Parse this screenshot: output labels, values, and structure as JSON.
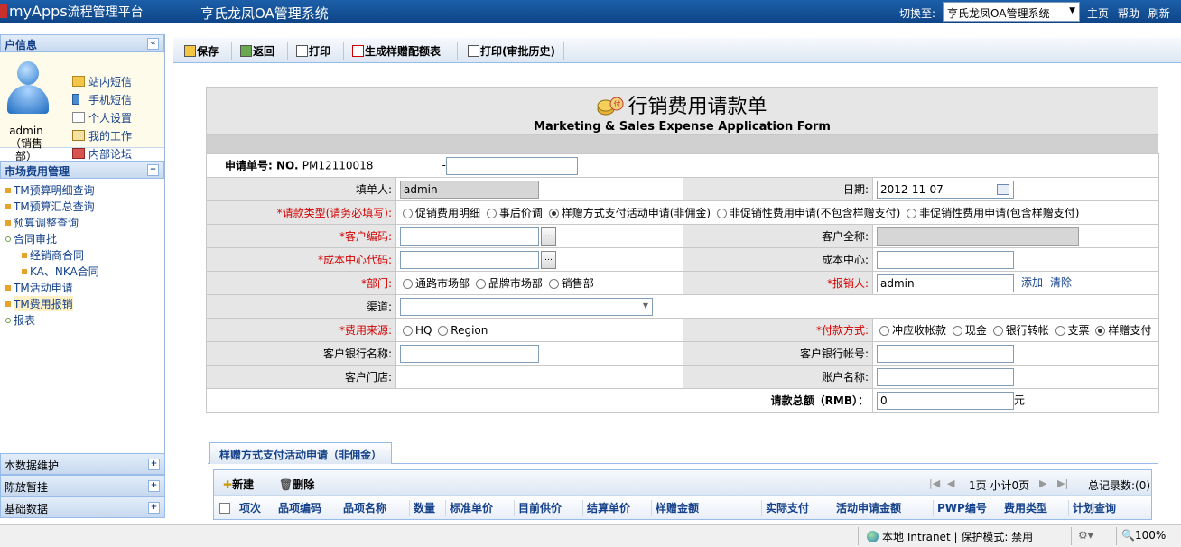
{
  "topbar": {
    "logo": "myApps",
    "logo_sub": "流程管理平台",
    "system_title": "亨氏龙凤OA管理系统",
    "switch_label": "切换至:",
    "switch_value": "亨氏龙凤OA管理系统",
    "link_home": "主页",
    "link_help": "帮助",
    "link_refresh": "刷新"
  },
  "sidebar": {
    "user_panel_title": "户信息",
    "username": "admin",
    "userdept": "（销售部）",
    "user_menu": [
      "站内短信",
      "手机短信",
      "个人设置",
      "我的工作",
      "内部论坛"
    ],
    "menu_panel_title": "市场费用管理",
    "tree": [
      "TM预算明细查询",
      "TM预算汇总查询",
      "预算调整查询",
      "合同审批",
      "经销商合同",
      "KA、NKA合同",
      "TM活动申请",
      "TM费用报销",
      "报表"
    ],
    "bottom_panels": [
      "本数据维护",
      "陈放暂挂",
      "基础数据"
    ]
  },
  "toolbar": {
    "save": "保存",
    "back": "返回",
    "print": "打印",
    "generate": "生成样赠配额表",
    "print_history": "打印(审批历史)"
  },
  "form": {
    "title_cn": "行销费用请款单",
    "title_en": "Marketing & Sales Expense Application Form",
    "apply_no_label": "申请单号:",
    "apply_no_prefix": "NO.",
    "apply_no_value": "PM12110018",
    "apply_no_dash": "-",
    "filler_label": "填单人:",
    "filler_value": "admin",
    "date_label": "日期:",
    "date_value": "2012-11-07",
    "type_label": "*请款类型(请务必填写):",
    "type_options": [
      "促销费用明细",
      "事后价调",
      "样赠方式支付活动申请(非佣金)",
      "非促销性费用申请(不包含样赠支付)",
      "非促销性费用申请(包含样赠支付)"
    ],
    "type_selected": 2,
    "cust_code_label": "*客户编码:",
    "cust_fullname_label": "客户全称:",
    "cost_center_code_label": "*成本中心代码:",
    "cost_center_label": "成本中心:",
    "dept_label": "*部门:",
    "dept_options": [
      "通路市场部",
      "品牌市场部",
      "销售部"
    ],
    "reimburser_label": "*报销人:",
    "reimburser_value": "admin",
    "add_link": "添加",
    "clear_link": "清除",
    "channel_label": "渠道:",
    "source_label": "*费用来源:",
    "source_options": [
      "HQ",
      "Region"
    ],
    "pay_method_label": "*付款方式:",
    "pay_options": [
      "冲应收帐款",
      "现金",
      "银行转帐",
      "支票",
      "样赠支付"
    ],
    "pay_selected": 4,
    "bank_name_label": "客户银行名称:",
    "bank_account_label": "客户银行帐号:",
    "store_label": "客户门店:",
    "account_name_label": "账户名称:",
    "total_label": "请款总额（RMB）：",
    "total_value": "0",
    "total_unit": "元"
  },
  "detail": {
    "tab_label": "样赠方式支付活动申请（非佣金）",
    "new_label": "新建",
    "delete_label": "删除",
    "page_info": "1页 小计0页",
    "total_records": "总记录数:(0)",
    "columns": [
      "项次",
      "品项编码",
      "品项名称",
      "数量",
      "标准单价",
      "目前供价",
      "结算单价",
      "样赠金额",
      "实际支付",
      "活动申请金额",
      "PWP编号",
      "费用类型",
      "计划查询"
    ]
  },
  "statusbar": {
    "zone": "本地 Intranet | 保护模式: 禁用",
    "zoom": "100%"
  }
}
